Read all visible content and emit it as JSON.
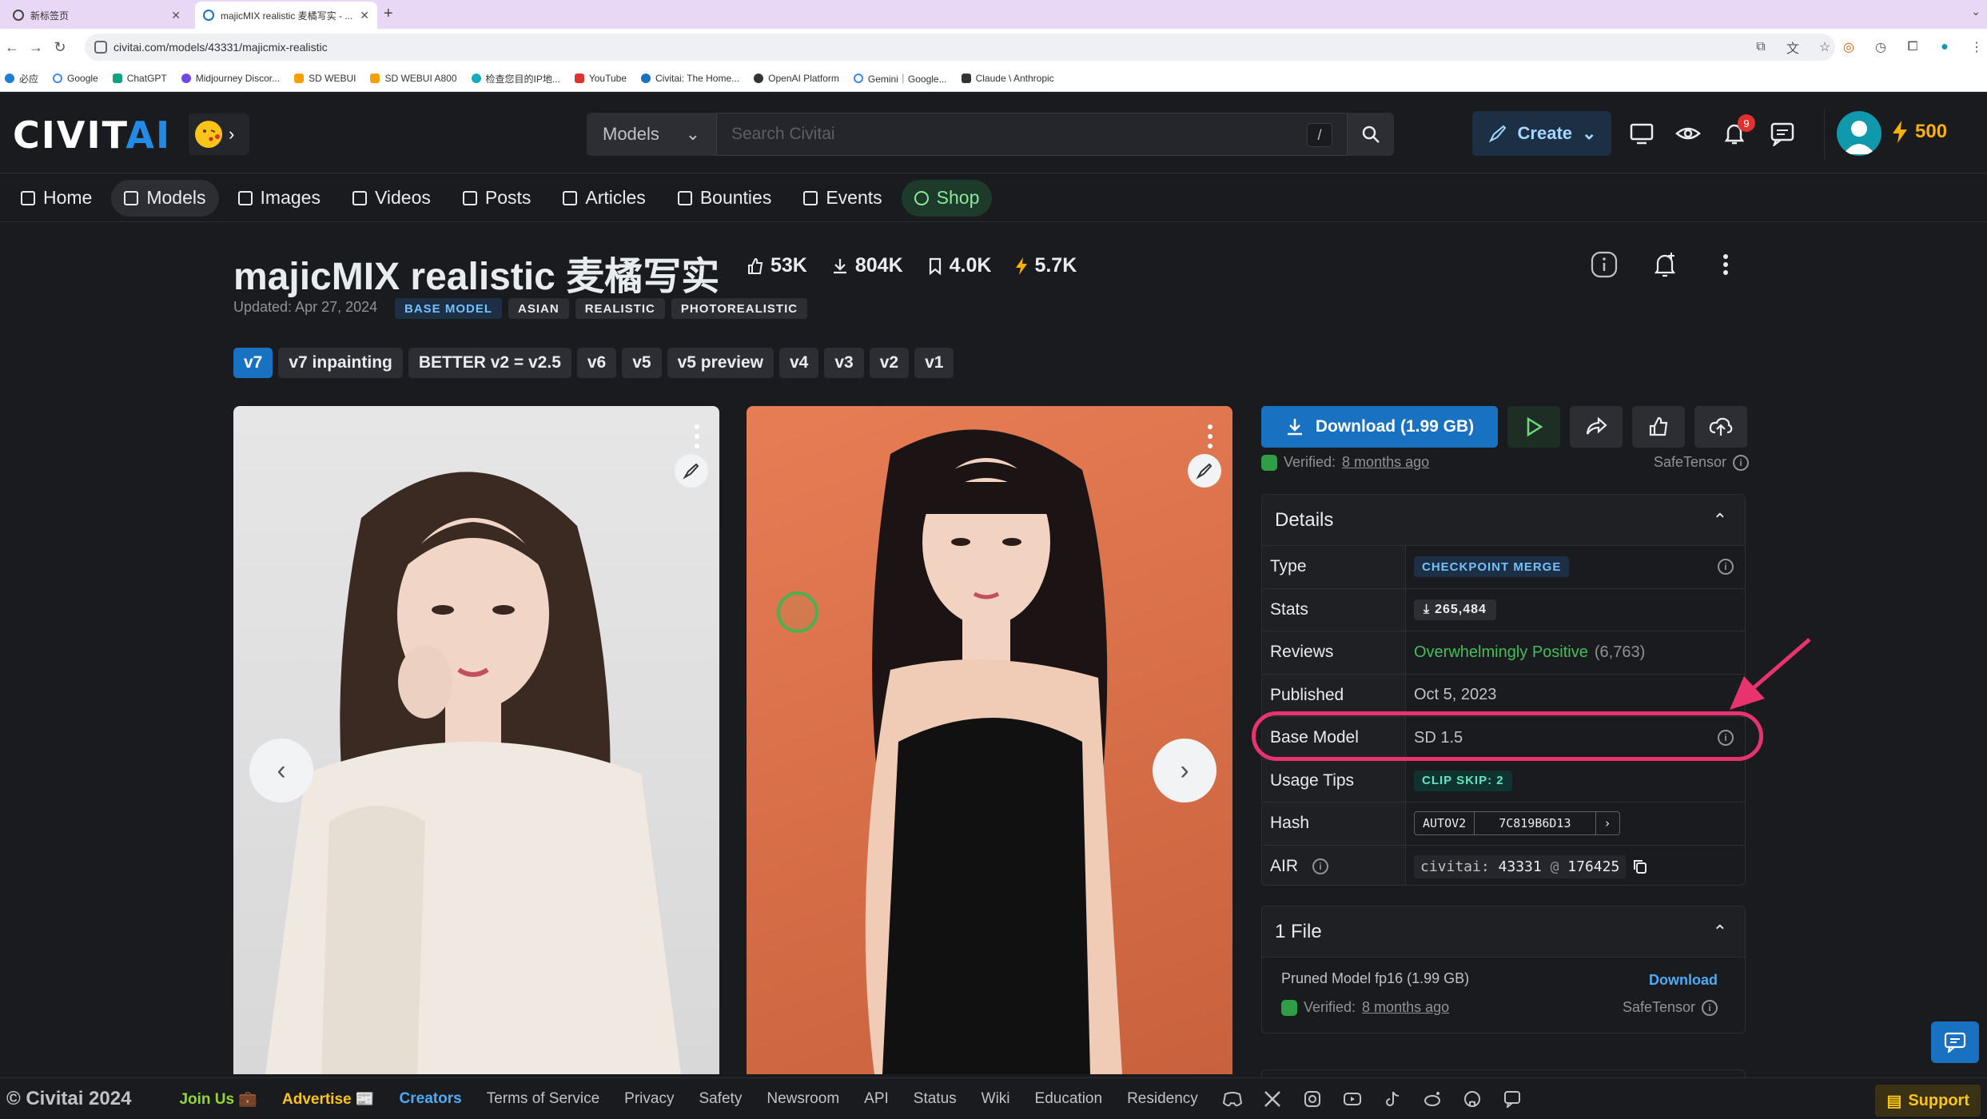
{
  "browser": {
    "tabs": [
      {
        "title": "新标签页"
      },
      {
        "title": "majicMIX realistic 麦橘写实 - ..."
      }
    ],
    "url": "civitai.com/models/43331/majicmix-realistic",
    "bookmarks": [
      "必应",
      "Google",
      "ChatGPT",
      "Midjourney Discor...",
      "SD WEBUI",
      "SD WEBUI A800",
      "检查您目的IP地...",
      "YouTube",
      "Civitai: The Home...",
      "OpenAI Platform",
      "Gemini｜Google...",
      "Claude \\ Anthropic"
    ]
  },
  "header": {
    "logo_main": "CIVIT",
    "logo_accent": "AI",
    "search_scope": "Models",
    "search_placeholder": "Search Civitai",
    "search_shortcut": "/",
    "create_label": "Create",
    "notification_count": "9",
    "buzz_amount": "500"
  },
  "nav": {
    "items": [
      "Home",
      "Models",
      "Images",
      "Videos",
      "Posts",
      "Articles",
      "Bounties",
      "Events",
      "Shop"
    ],
    "active": "Models"
  },
  "model": {
    "title": "majicMIX realistic 麦橘写实",
    "stats": {
      "likes": "53K",
      "downloads": "804K",
      "bookmarks": "4.0K",
      "buzz": "5.7K"
    },
    "updated": "Updated: Apr 27, 2024",
    "tags": [
      "BASE MODEL",
      "ASIAN",
      "REALISTIC",
      "PHOTOREALISTIC"
    ],
    "versions": [
      "v7",
      "v7 inpainting",
      "BETTER v2 = v2.5",
      "v6",
      "v5",
      "v5 preview",
      "v4",
      "v3",
      "v2",
      "v1"
    ],
    "active_version": "v7"
  },
  "actions": {
    "download_label": "Download (1.99 GB)",
    "verified_prefix": "Verified:",
    "verified_time": "8 months ago",
    "safetensor": "SafeTensor"
  },
  "details": {
    "heading": "Details",
    "type_label": "Type",
    "type_value": "CHECKPOINT MERGE",
    "stats_label": "Stats",
    "stats_value": "265,484",
    "reviews_label": "Reviews",
    "reviews_value": "Overwhelmingly Positive",
    "reviews_count": "(6,763)",
    "published_label": "Published",
    "published_value": "Oct 5, 2023",
    "base_model_label": "Base Model",
    "base_model_value": "SD 1.5",
    "usage_tips_label": "Usage Tips",
    "usage_tips_value": "CLIP SKIP: 2",
    "hash_label": "Hash",
    "hash_type": "AUTOV2",
    "hash_value": "7C819B6D13",
    "air_label": "AIR",
    "air_prefix": "civitai:",
    "air_model_id": "43331",
    "air_at": "@",
    "air_version_id": "176425"
  },
  "files": {
    "heading": "1 File",
    "file_name": "Pruned Model fp16 (1.99 GB)",
    "download_label": "Download",
    "verified_prefix": "Verified:",
    "verified_time": "8 months ago",
    "safetensor": "SafeTensor"
  },
  "footer": {
    "copyright": "© Civitai 2024",
    "join_us": "Join Us 💼",
    "advertise": "Advertise 📰",
    "creators": "Creators",
    "terms": "Terms of Service",
    "privacy": "Privacy",
    "safety": "Safety",
    "newsroom": "Newsroom",
    "api": "API",
    "status": "Status",
    "wiki": "Wiki",
    "education": "Education",
    "residency": "Residency",
    "support": "Support"
  },
  "colors": {
    "background": "#1a1b1e",
    "accent_blue": "#1971c2",
    "positive_green": "#40c057",
    "buzz_yellow": "#fab005",
    "annotation_pink": "#e8336e"
  }
}
